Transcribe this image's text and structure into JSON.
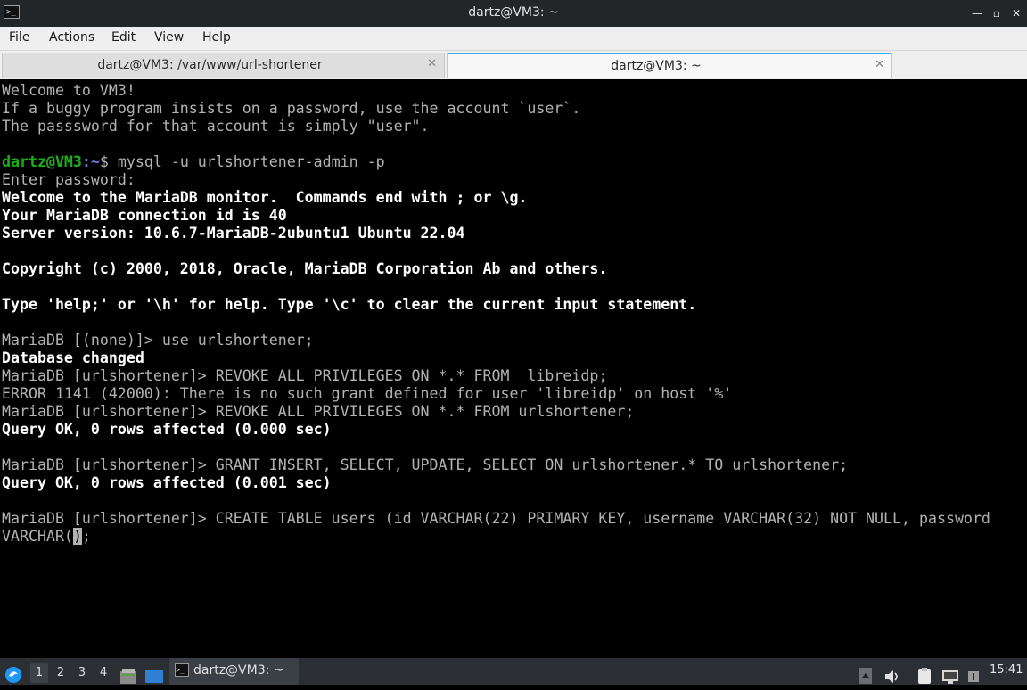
{
  "window": {
    "title": "dartz@VM3: ~"
  },
  "menu": {
    "items": [
      "File",
      "Actions",
      "Edit",
      "View",
      "Help"
    ]
  },
  "tabs": [
    {
      "label": "dartz@VM3: /var/www/url-shortener",
      "active": false
    },
    {
      "label": "dartz@VM3: ~",
      "active": true
    }
  ],
  "terminal": {
    "lines": [
      "Welcome to VM3!",
      "If a buggy program insists on a password, use the account `user`.",
      "The passsword for that account is simply \"user\".",
      "",
      "",
      "Enter password:",
      "Welcome to the MariaDB monitor.  Commands end with ; or \\g.",
      "Your MariaDB connection id is 40",
      "Server version: 10.6.7-MariaDB-2ubuntu1 Ubuntu 22.04",
      "",
      "Copyright (c) 2000, 2018, Oracle, MariaDB Corporation Ab and others.",
      "",
      "Type 'help;' or '\\h' for help. Type '\\c' to clear the current input statement.",
      "",
      "MariaDB [(none)]> use urlshortener;",
      "Database changed",
      "MariaDB [urlshortener]> REVOKE ALL PRIVILEGES ON *.* FROM  libreidp;",
      "ERROR 1141 (42000): There is no such grant defined for user 'libreidp' on host '%'",
      "MariaDB [urlshortener]> REVOKE ALL PRIVILEGES ON *.* FROM urlshortener;",
      "Query OK, 0 rows affected (0.000 sec)",
      "",
      "MariaDB [urlshortener]> GRANT INSERT, SELECT, UPDATE, SELECT ON urlshortener.* TO urlshortener;",
      "Query OK, 0 rows affected (0.001 sec)",
      "",
      "MariaDB [urlshortener]> CREATE TABLE users (id VARCHAR(22) PRIMARY KEY, username VARCHAR(32) NOT NULL, password"
    ],
    "shell_prompt": {
      "user_host": "dartz@VM3",
      "path": ":~",
      "symbol": "$ ",
      "command": "mysql -u urlshortener-admin -p"
    },
    "last_line": {
      "before_cursor": "VARCHAR(",
      "cursor_char": ")",
      "after_cursor": ";"
    }
  },
  "taskbar": {
    "desktops": [
      "1",
      "2",
      "3",
      "4"
    ],
    "task_label": "dartz@VM3: ~",
    "clock": "15:41"
  },
  "colors": {
    "titlebar": "#232629",
    "menubar": "#efefef",
    "active_tab_accent": "#3daee9",
    "terminal_bg": "#000000",
    "prompt_user": "#18b218",
    "prompt_path": "#6e7bd8",
    "taskbar": "#2b2e33"
  }
}
